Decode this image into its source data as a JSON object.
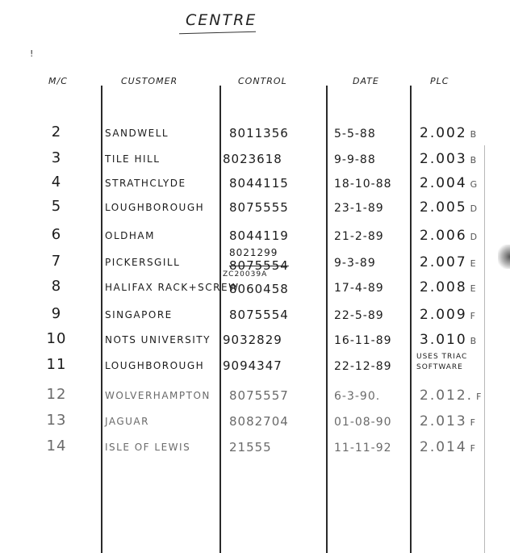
{
  "document": {
    "title": "CENTRE",
    "columns": [
      "M/C",
      "CUSTOMER",
      "CONTROL",
      "DATE",
      "PLC"
    ],
    "rows": [
      {
        "mc": "2",
        "customer": "SANDWELL",
        "control": "8011356",
        "control_note": "",
        "control_struck": "",
        "date": "5-5-88",
        "plc": "2.002",
        "plc_suffix": "B"
      },
      {
        "mc": "3",
        "customer": "TILE HILL",
        "control": "8023618",
        "control_note": "",
        "control_struck": "",
        "date": "9-9-88",
        "plc": "2.003",
        "plc_suffix": "B"
      },
      {
        "mc": "4",
        "customer": "STRATHCLYDE",
        "control": "8044115",
        "control_note": "",
        "control_struck": "",
        "date": "18-10-88",
        "plc": "2.004",
        "plc_suffix": "G"
      },
      {
        "mc": "5",
        "customer": "LOUGHBOROUGH",
        "control": "8075555",
        "control_note": "",
        "control_struck": "",
        "date": "23-1-89",
        "plc": "2.005",
        "plc_suffix": "D"
      },
      {
        "mc": "6",
        "customer": "OLDHAM",
        "control": "8044119",
        "control_note": "",
        "control_struck": "",
        "date": "21-2-89",
        "plc": "2.006",
        "plc_suffix": "D"
      },
      {
        "mc": "7",
        "customer": "PICKERSGILL",
        "control": "8021299",
        "control_note": "",
        "control_struck": "8075554",
        "date": "9-3-89",
        "plc": "2.007",
        "plc_suffix": "E"
      },
      {
        "mc": "8",
        "customer": "HALIFAX RACK+SCREW",
        "control": "8060458",
        "control_note": "ZC20039A",
        "control_struck": "",
        "date": "17-4-89",
        "plc": "2.008",
        "plc_suffix": "E"
      },
      {
        "mc": "9",
        "customer": "SINGAPORE",
        "control": "8075554",
        "control_note": "",
        "control_struck": "",
        "date": "22-5-89",
        "plc": "2.009",
        "plc_suffix": "F"
      },
      {
        "mc": "10",
        "customer": "NOTS UNIVERSITY",
        "control": "9032829",
        "control_note": "",
        "control_struck": "",
        "date": "16-11-89",
        "plc": "3.010",
        "plc_suffix": "B"
      },
      {
        "mc": "11",
        "customer": "LOUGHBOROUGH",
        "control": "9094347",
        "control_note": "",
        "control_struck": "",
        "date": "22-12-89",
        "plc": "USES TRIAC SOFTWARE",
        "plc_suffix": ""
      },
      {
        "mc": "12",
        "customer": "WOLVERHAMPTON",
        "control": "8075557",
        "control_note": "",
        "control_struck": "",
        "date": "6-3-90.",
        "plc": "2.012.",
        "plc_suffix": "F"
      },
      {
        "mc": "13",
        "customer": "JAGUAR",
        "control": "8082704",
        "control_note": "",
        "control_struck": "",
        "date": "01-08-90",
        "plc": "2.013",
        "plc_suffix": "F"
      },
      {
        "mc": "14",
        "customer": "ISLE OF LEWIS",
        "control": "21555",
        "control_note": "",
        "control_struck": "",
        "date": "11-11-92",
        "plc": "2.014",
        "plc_suffix": "F"
      }
    ]
  }
}
